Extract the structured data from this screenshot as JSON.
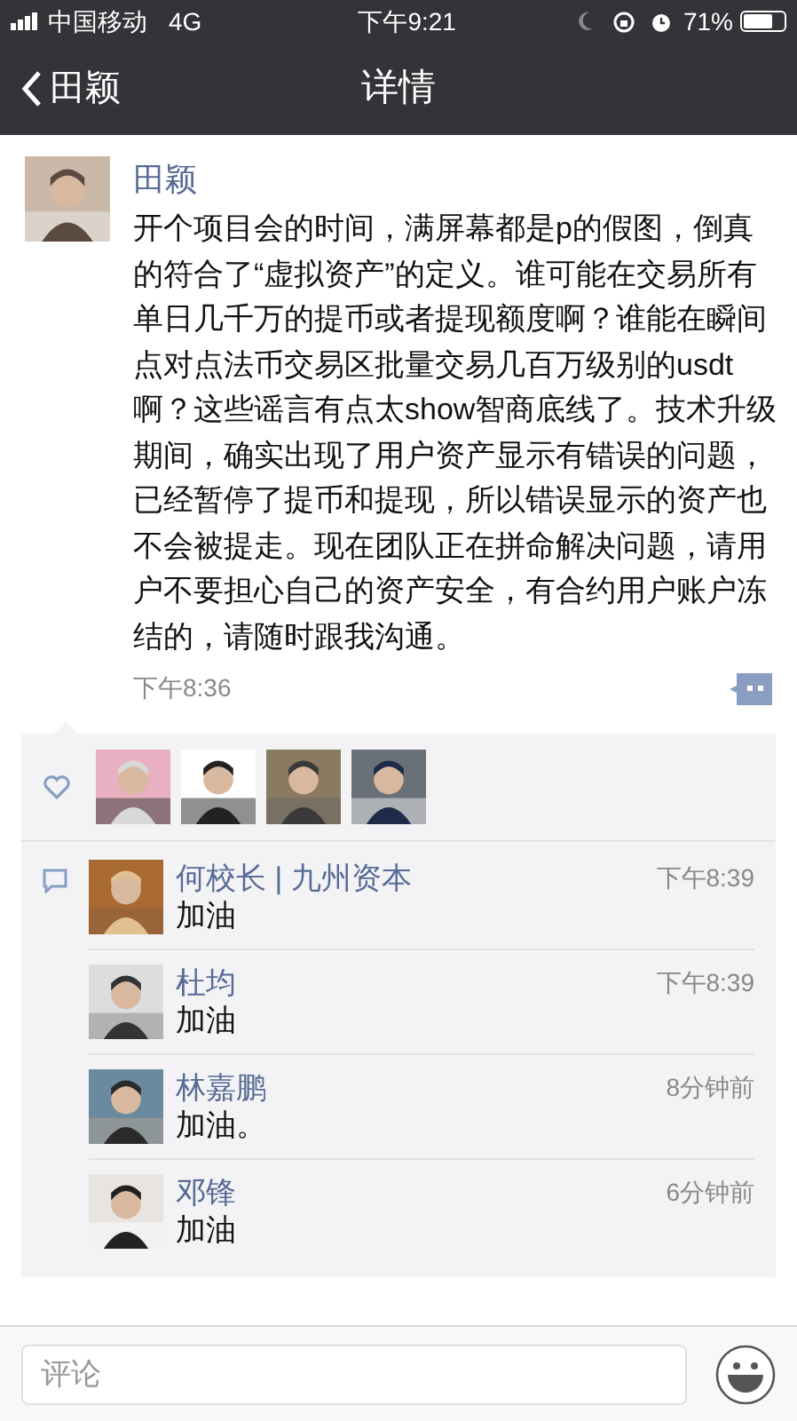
{
  "status_bar": {
    "carrier": "中国移动",
    "network": "4G",
    "time": "下午9:21",
    "battery": "71%"
  },
  "nav": {
    "back": "田颖",
    "title": "详情"
  },
  "post": {
    "author": "田颖",
    "text": "开个项目会的时间，满屏幕都是p的假图，倒真的符合了“虚拟资产”的定义。谁可能在交易所有单日几千万的提币或者提现额度啊？谁能在瞬间点对点法币交易区批量交易几百万级别的usdt啊？这些谣言有点太show智商底线了。技术升级期间，确实出现了用户资产显示有错误的问题，已经暂停了提币和提现，所以错误显示的资产也不会被提走。现在团队正在拼命解决问题，请用户不要担心自己的资产安全，有合约用户账户冻结的，请随时跟我沟通。",
    "time": "下午8:36"
  },
  "comments": [
    {
      "name": "何校长 | 九州资本",
      "time": "下午8:39",
      "text": "加油"
    },
    {
      "name": "杜均",
      "time": "下午8:39",
      "text": "加油"
    },
    {
      "name": "林嘉鹏",
      "time": "8分钟前",
      "text": "加油。"
    },
    {
      "name": "邓锋",
      "time": "6分钟前",
      "text": "加油"
    }
  ],
  "input": {
    "placeholder": "评论"
  }
}
